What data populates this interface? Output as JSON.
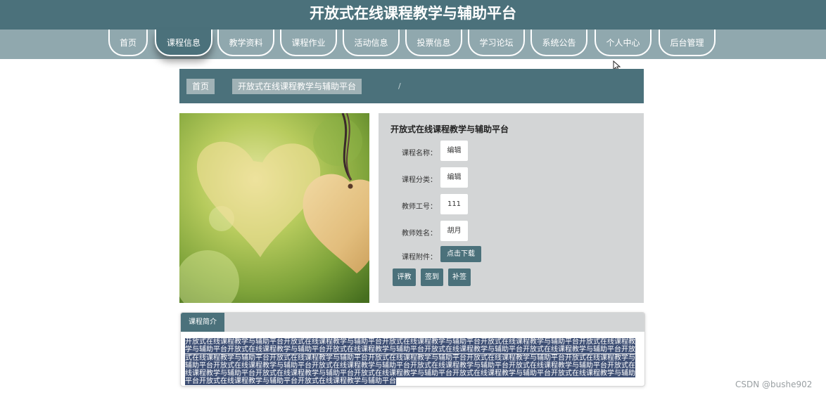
{
  "header": {
    "title": "开放式在线课程教学与辅助平台"
  },
  "nav": {
    "items": [
      {
        "label": "首页"
      },
      {
        "label": "课程信息"
      },
      {
        "label": "教学资料"
      },
      {
        "label": "课程作业"
      },
      {
        "label": "活动信息"
      },
      {
        "label": "投票信息"
      },
      {
        "label": "学习论坛"
      },
      {
        "label": "系统公告"
      },
      {
        "label": "个人中心"
      },
      {
        "label": "后台管理"
      }
    ],
    "active_label": "课程信息"
  },
  "breadcrumb": {
    "home": "首页",
    "separator": "/",
    "current": "开放式在线课程教学与辅助平台"
  },
  "course": {
    "title": "开放式在线课程教学与辅助平台",
    "fields": [
      {
        "label": "课程名称：",
        "value": "编辑"
      },
      {
        "label": "课程分类：",
        "value": "编辑"
      },
      {
        "label": "教师工号：",
        "value": "111"
      },
      {
        "label": "教师姓名：",
        "value": "胡月"
      }
    ],
    "attachment_label": "课程附件：",
    "download_label": "点击下载",
    "actions": {
      "evaluate": "评教",
      "signin": "签到",
      "makeup": "补签"
    }
  },
  "intro": {
    "tab_label": "课程简介",
    "text": "开放式在线课程教学与辅助平台开放式在线课程教学与辅助平台开放式在线课程教学与辅助平台开放式在线课程教学与辅助平台开放式在线课程教学与辅助平台开放式在线课程教学与辅助平台开放式在线课程教学与辅助平台开放式在线课程教学与辅助平台开放式在线课程教学与辅助平台开放式在线课程教学与辅助平台开放式在线课程教学与辅助平台开放式在线课程教学与辅助平台开放式在线课程教学与辅助平台开放式在线课程教学与辅助平台开放式在线课程教学与辅助平台开放式在线课程教学与辅助平台开放式在线课程教学与辅助平台开放式在线课程教学与辅助平台开放式在线课程教学与辅助平台开放式在线课程教学与辅助平台开放式在线课程教学与辅助平台开放式在线课程教学与辅助平台开放式在线课程教学与辅助平台开放式在线课程教学与辅助平台开放式在线课程教学与辅助平台"
  },
  "watermark": "CSDN @bushe902",
  "colors": {
    "primary": "#4b717b",
    "nav_background": "#90a8ae",
    "panel_background": "#d3d5d6",
    "selection_highlight": "#3e4f74"
  }
}
